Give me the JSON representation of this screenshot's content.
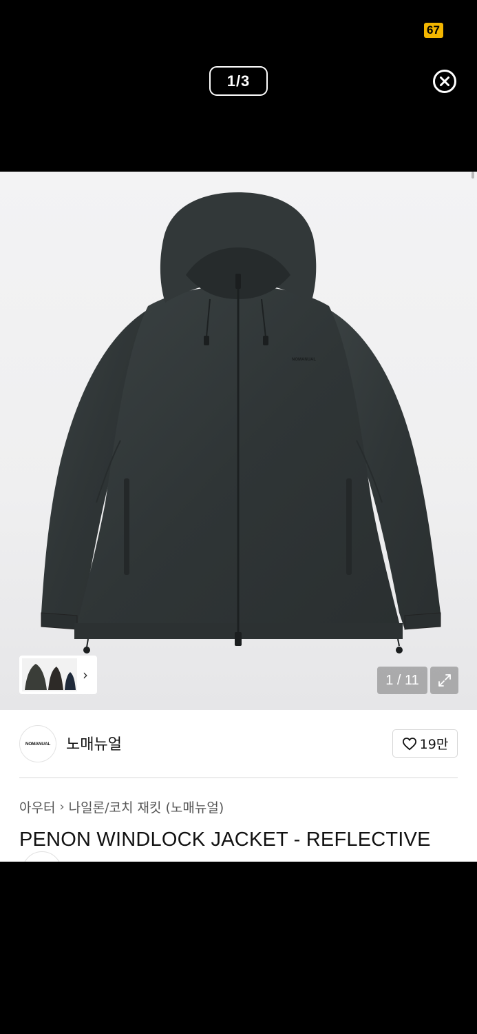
{
  "viewer": {
    "status_badge": "67",
    "page_indicator": "1/3"
  },
  "product": {
    "image_counter": "1 / 11",
    "brand": {
      "logo_text": "NOMANUAL",
      "name": "노매뉴얼"
    },
    "likes": "19만",
    "breadcrumb": {
      "category": "아우터",
      "subcategory": "나일론/코치 재킷 (노매뉴얼)"
    },
    "title": "PENON WINDLOCK JACKET - REFLECTIVE",
    "jacket_logo": "NOMANUAL"
  },
  "icons": {
    "close": "close-circle-icon",
    "expand": "expand-icon",
    "heart": "heart-icon",
    "chevron": "chevron-right-icon"
  },
  "colors": {
    "jacket": "#33393a",
    "badge": "#f3b600",
    "background_top": "#000000"
  }
}
